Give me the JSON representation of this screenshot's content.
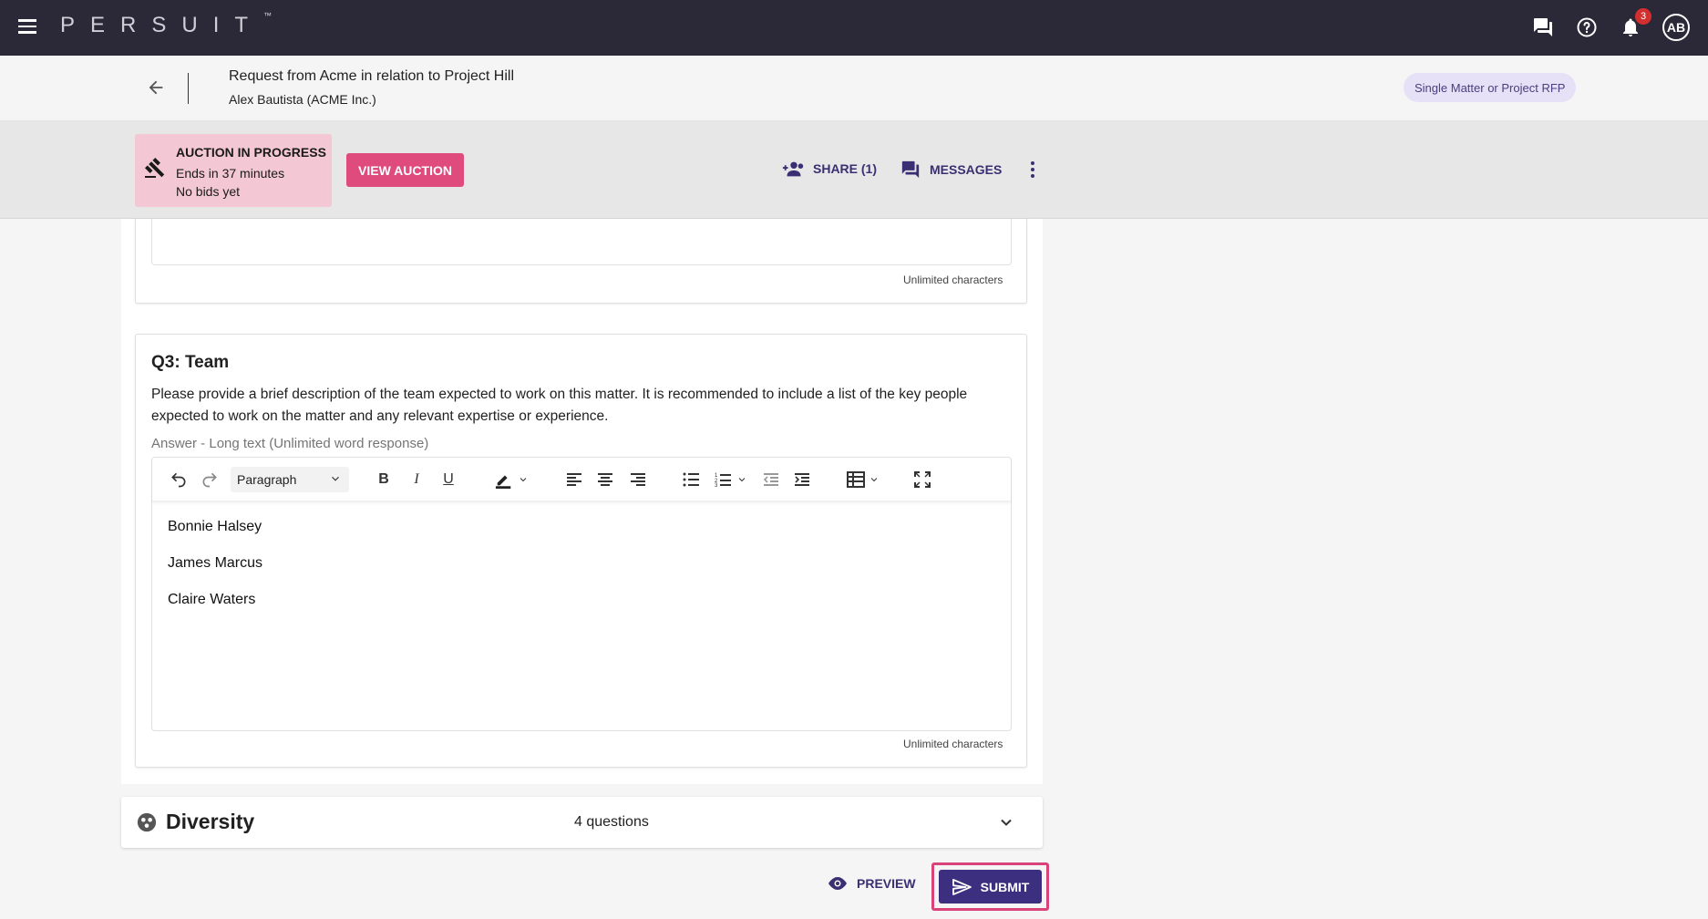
{
  "nav": {
    "logo_text": "PERSUIT",
    "logo_tm": "™",
    "notification_count": "3",
    "avatar_initials": "AB"
  },
  "header": {
    "title": "Request from Acme in relation to Project Hill",
    "subtitle": "Alex Bautista (ACME Inc.)",
    "rfp_type": "Single Matter or Project RFP"
  },
  "auction": {
    "status": "AUCTION IN PROGRESS",
    "ends": "Ends in 37 minutes",
    "bids": "No bids yet",
    "view_label": "VIEW AUCTION",
    "share_label": "SHARE (1)",
    "messages_label": "MESSAGES"
  },
  "previous_question": {
    "char_limit": "Unlimited characters"
  },
  "question": {
    "title": "Q3: Team",
    "description": "Please provide a brief description of the team expected to work on this matter. It is recommended to include a list of the key people expected to work on the matter and any relevant expertise or experience.",
    "answer_label": "Answer - Long text (Unlimited word response)",
    "block_format": "Paragraph",
    "answer_lines": [
      "Bonnie Halsey",
      "James Marcus",
      "Claire Waters"
    ],
    "char_limit": "Unlimited characters"
  },
  "diversity": {
    "title": "Diversity",
    "count": "4 questions"
  },
  "footer": {
    "preview_label": "PREVIEW",
    "submit_label": "SUBMIT"
  },
  "colors": {
    "nav_bg": "#2b2838",
    "accent_purple": "#3d2f80",
    "accent_pink": "#de4b7c",
    "auction_bg": "#f3c7d4",
    "chip_bg": "#e6e1f7"
  }
}
